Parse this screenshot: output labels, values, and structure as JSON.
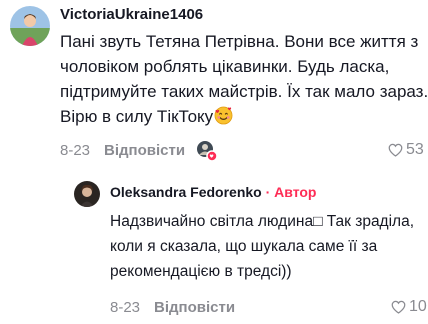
{
  "comment": {
    "username": "VictoriaUkraine1406",
    "text_lines": [
      "Пані звуть Тетяна Петрівна. Вони все життя з",
      "чоловіком роблять цікавинки. Будь ласка,",
      "підтримуйте таких майстрів. Їх так мало зараз.",
      "Вірю в силу ТікТоку"
    ],
    "emoji_icon": "smiling-face-with-hearts-icon",
    "date": "8-23",
    "reply_label": "Відповісти",
    "likes": "53"
  },
  "reply": {
    "username": "Oleksandra Fedorenko",
    "separator": " · ",
    "badge": "Автор",
    "text_lines": [
      "Надзвичайно світла людина□ Так зраділа,",
      "коли я сказала, що шукала саме її за",
      "рекомендацією в тредсі))"
    ],
    "date": "8-23",
    "reply_label": "Відповісти",
    "likes": "10"
  },
  "colors": {
    "text": "#161823",
    "secondary": "#8a8b91",
    "author_accent": "#fe2c55"
  }
}
